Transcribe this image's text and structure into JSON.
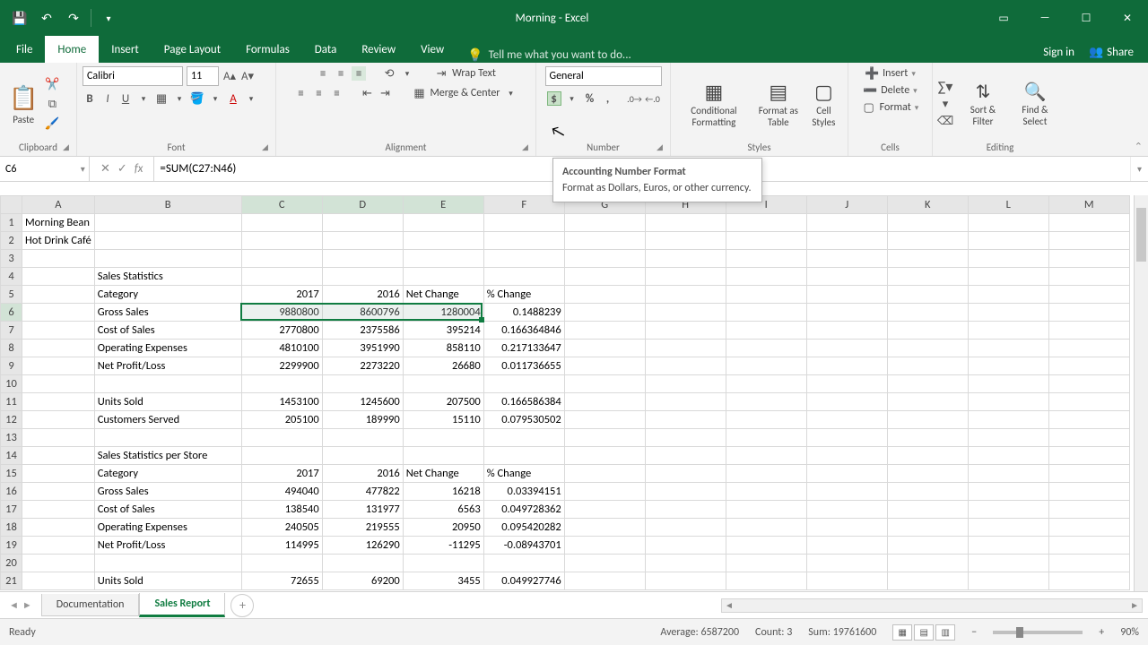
{
  "title": "Morning - Excel",
  "tabs": {
    "file": "File",
    "home": "Home",
    "insert": "Insert",
    "pageLayout": "Page Layout",
    "formulas": "Formulas",
    "data": "Data",
    "review": "Review",
    "view": "View"
  },
  "tellme": "Tell me what you want to do...",
  "signin": "Sign in",
  "share": "Share",
  "ribbon": {
    "clipboard": {
      "label": "Clipboard",
      "paste": "Paste"
    },
    "font": {
      "label": "Font",
      "name": "Calibri",
      "size": "11"
    },
    "alignment": {
      "label": "Alignment",
      "wrap": "Wrap Text",
      "merge": "Merge & Center"
    },
    "number": {
      "label": "Number",
      "format": "General"
    },
    "styles": {
      "label": "Styles",
      "conditional": "Conditional Formatting",
      "formatTable": "Format as Table",
      "cellStyles": "Cell Styles"
    },
    "cells": {
      "label": "Cells",
      "insert": "Insert",
      "delete": "Delete",
      "format": "Format"
    },
    "editing": {
      "label": "Editing",
      "sort": "Sort & Filter",
      "find": "Find & Select"
    }
  },
  "tooltip": {
    "title": "Accounting Number Format",
    "body": "Format as Dollars, Euros, or other currency."
  },
  "nameBox": "C6",
  "formula": "=SUM(C27:N46)",
  "columns": [
    "A",
    "B",
    "C",
    "D",
    "E",
    "F",
    "G",
    "H",
    "I",
    "J",
    "K",
    "L",
    "M"
  ],
  "rows": [
    {
      "n": 1,
      "cells": {
        "A": "Morning Bean"
      }
    },
    {
      "n": 2,
      "cells": {
        "A": "Hot Drink Café"
      }
    },
    {
      "n": 3,
      "cells": {}
    },
    {
      "n": 4,
      "cells": {
        "B": "Sales Statistics"
      }
    },
    {
      "n": 5,
      "cells": {
        "B": "Category",
        "C": "2017",
        "D": "2016",
        "E": "Net Change",
        "F": "% Change"
      },
      "eLeft": true,
      "fLeft": true
    },
    {
      "n": 6,
      "cells": {
        "B": "Gross Sales",
        "C": "9880800",
        "D": "8600796",
        "E": "1280004",
        "F": "0.1488239"
      }
    },
    {
      "n": 7,
      "cells": {
        "B": "Cost of Sales",
        "C": "2770800",
        "D": "2375586",
        "E": "395214",
        "F": "0.166364846"
      }
    },
    {
      "n": 8,
      "cells": {
        "B": "Operating Expenses",
        "C": "4810100",
        "D": "3951990",
        "E": "858110",
        "F": "0.217133647"
      }
    },
    {
      "n": 9,
      "cells": {
        "B": "Net Profit/Loss",
        "C": "2299900",
        "D": "2273220",
        "E": "26680",
        "F": "0.011736655"
      }
    },
    {
      "n": 10,
      "cells": {}
    },
    {
      "n": 11,
      "cells": {
        "B": "Units Sold",
        "C": "1453100",
        "D": "1245600",
        "E": "207500",
        "F": "0.166586384"
      }
    },
    {
      "n": 12,
      "cells": {
        "B": "Customers Served",
        "C": "205100",
        "D": "189990",
        "E": "15110",
        "F": "0.079530502"
      }
    },
    {
      "n": 13,
      "cells": {}
    },
    {
      "n": 14,
      "cells": {
        "B": "Sales Statistics per Store"
      }
    },
    {
      "n": 15,
      "cells": {
        "B": "Category",
        "C": "2017",
        "D": "2016",
        "E": "Net Change",
        "F": "% Change"
      },
      "eLeft": true,
      "fLeft": true
    },
    {
      "n": 16,
      "cells": {
        "B": "Gross Sales",
        "C": "494040",
        "D": "477822",
        "E": "16218",
        "F": "0.03394151"
      }
    },
    {
      "n": 17,
      "cells": {
        "B": "Cost of Sales",
        "C": "138540",
        "D": "131977",
        "E": "6563",
        "F": "0.049728362"
      }
    },
    {
      "n": 18,
      "cells": {
        "B": "Operating Expenses",
        "C": "240505",
        "D": "219555",
        "E": "20950",
        "F": "0.095420282"
      }
    },
    {
      "n": 19,
      "cells": {
        "B": "Net Profit/Loss",
        "C": "114995",
        "D": "126290",
        "E": "-11295",
        "F": "-0.08943701"
      }
    },
    {
      "n": 20,
      "cells": {}
    },
    {
      "n": 21,
      "cells": {
        "B": "Units Sold",
        "C": "72655",
        "D": "69200",
        "E": "3455",
        "F": "0.049927746"
      }
    }
  ],
  "sheets": {
    "documentation": "Documentation",
    "salesReport": "Sales Report"
  },
  "status": {
    "ready": "Ready",
    "average": "Average: 6587200",
    "count": "Count: 3",
    "sum": "Sum: 19761600",
    "zoom": "90%"
  }
}
